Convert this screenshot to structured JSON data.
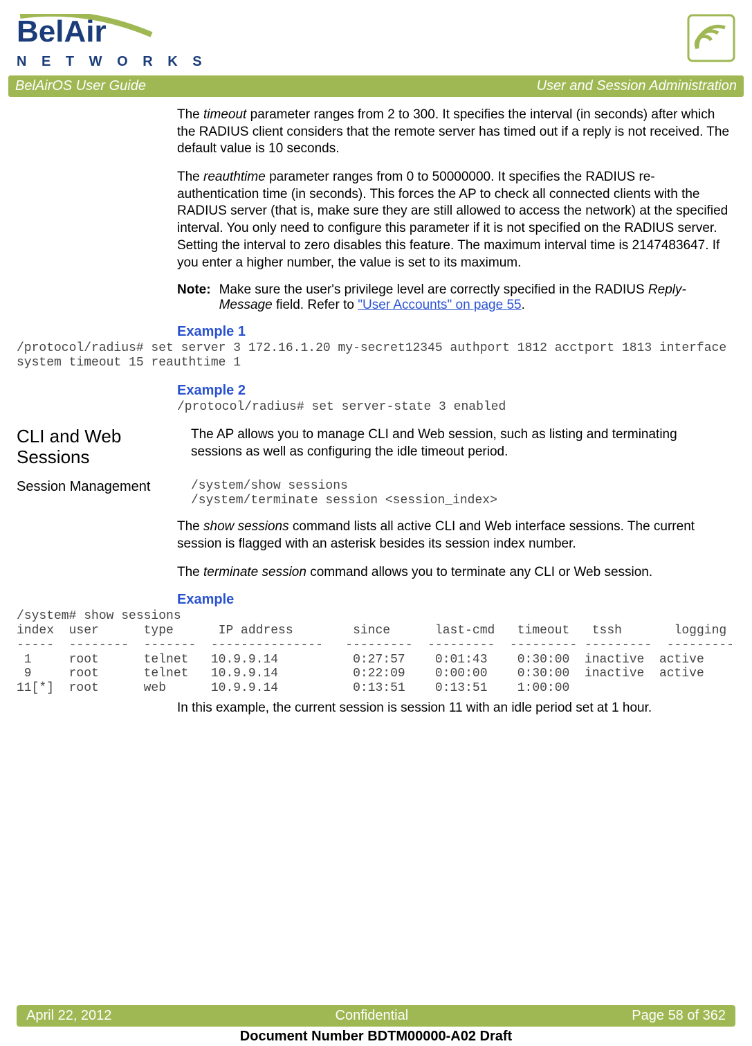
{
  "logo": {
    "networks": "N E T W O R K S"
  },
  "header": {
    "left": "BelAirOS User Guide",
    "right": "User and Session Administration"
  },
  "body": {
    "p1_a": "The ",
    "p1_b": "timeout",
    "p1_c": " parameter ranges from 2 to 300. It specifies the interval (in seconds) after which the RADIUS client considers that the remote server has timed out if a reply is not received. The default value is 10 seconds.",
    "p2_a": "The ",
    "p2_b": "reauthtime",
    "p2_c": " parameter ranges from 0 to 50000000. It specifies the RADIUS re-authentication time (in seconds). This forces the AP to check all connected clients with the RADIUS server (that is, make sure they are still allowed to access the network) at the specified interval. You only need to configure this parameter if it is not specified on the RADIUS server. Setting the interval to zero disables this feature. The maximum interval time is 2147483647. If you enter a higher number, the value is set to its maximum.",
    "note_label": "Note:",
    "note_a": "Make sure the user's privilege level are correctly specified in the RADIUS ",
    "note_b": "Reply-Message",
    "note_c": " field. Refer to ",
    "note_link": "\"User Accounts\" on page 55",
    "note_d": ".",
    "ex1_hdr": "Example 1",
    "ex1_cmd": "/protocol/radius# set server 3 172.16.1.20 my-secret12345 authport 1812 acctport 1813 interface system timeout 15 reauthtime 1",
    "ex2_hdr": "Example 2",
    "ex2_cmd": "/protocol/radius# set server-state 3 enabled",
    "sec_title": "CLI and Web Sessions",
    "sec_intro": "The AP allows you to manage CLI and Web session, such as listing and terminating sessions as well as configuring the idle timeout period.",
    "sub_title": "Session Management",
    "sub_cmds": "/system/show sessions\n/system/terminate session <session_index>",
    "p3_a": "The ",
    "p3_b": "show sessions",
    "p3_c": " command lists all active CLI and Web interface sessions. The current session is flagged with an asterisk besides its session index number.",
    "p4_a": "The ",
    "p4_b": "terminate session",
    "p4_c": " command allows you to terminate any CLI or Web session.",
    "ex3_hdr": "Example",
    "ex3_out": "/system# show sessions\nindex  user      type      IP address        since      last-cmd   timeout   tssh       logging\n-----  --------  -------  ---------------   ---------  ---------  --------- ---------  ---------\n 1     root      telnet   10.9.9.14          0:27:57    0:01:43    0:30:00  inactive  active\n 9     root      telnet   10.9.9.14          0:22:09    0:00:00    0:30:00  inactive  active\n11[*]  root      web      10.9.9.14          0:13:51    0:13:51    1:00:00",
    "p5": "In this example, the current session is session 11 with an idle period set at 1 hour."
  },
  "footer": {
    "left": "April 22, 2012",
    "center": "Confidential",
    "right": "Page 58 of 362",
    "docnum": "Document Number BDTM00000-A02 Draft"
  }
}
